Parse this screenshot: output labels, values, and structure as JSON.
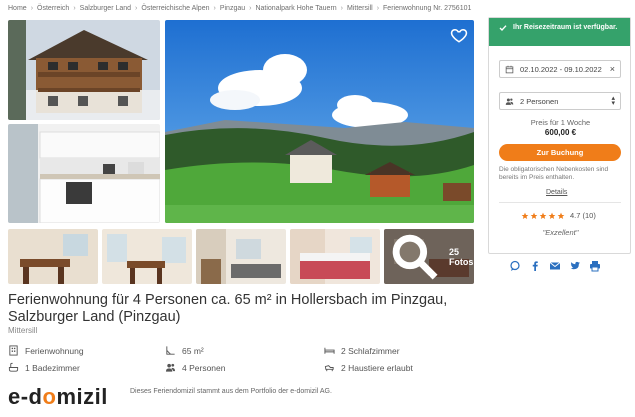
{
  "breadcrumb": [
    "Home",
    "Österreich",
    "Salzburger Land",
    "Österreichische Alpen",
    "Pinzgau",
    "Nationalpark Hohe Tauern",
    "Mittersill",
    "Ferienwohnung Nr. 2756101"
  ],
  "gallery": {
    "more_photos_label": "25 Fotos"
  },
  "title": "Ferienwohnung für 4 Personen ca. 65 m² in Hollersbach im Pinzgau, Salzburger Land (Pinzgau)",
  "location": "Mittersill",
  "features": [
    {
      "icon": "building-icon",
      "label": "Ferienwohnung"
    },
    {
      "icon": "area-icon",
      "label": "65 m²"
    },
    {
      "icon": "bed-icon",
      "label": "2 Schlafzimmer"
    },
    {
      "icon": "bath-icon",
      "label": "1 Badezimmer"
    },
    {
      "icon": "people-icon",
      "label": "4 Personen"
    },
    {
      "icon": "pet-icon",
      "label": "2 Haustiere erlaubt"
    }
  ],
  "branding": {
    "logo_part1": "e-d",
    "logo_accent": "o",
    "logo_part2": "mizil",
    "note": "Dieses Feriendomizil stammt aus dem Portfolio der e-domizil AG."
  },
  "booking": {
    "availability": "Ihr Reisezeitraum ist verfügbar.",
    "dates_value": "02.10.2022 - 09.10.2022",
    "guests_value": "2 Personen",
    "price_label": "Preis für 1 Woche",
    "price_value": "600,00 €",
    "book_button": "Zur Buchung",
    "cost_note": "Die obligatorischen Nebenkosten sind bereits im Preis enthalten.",
    "details_link": "Details",
    "rating_value": "4.7 (10)",
    "rating_stars": 4.7,
    "rating_word": "\"Exzellent\""
  },
  "colors": {
    "accent_orange": "#f07d19",
    "available_green": "#35a26b",
    "share_blue": "#2a6fbf"
  },
  "share_icons": [
    "whatsapp-icon",
    "facebook-icon",
    "mail-icon",
    "twitter-icon",
    "print-icon"
  ]
}
